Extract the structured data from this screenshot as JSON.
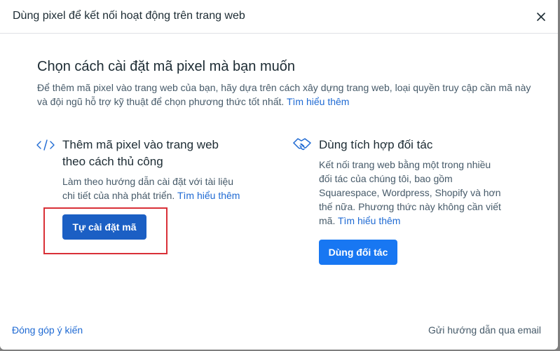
{
  "dialog": {
    "title": "Dùng pixel để kết nối hoạt động trên trang web"
  },
  "intro": {
    "heading": "Chọn cách cài đặt mã pixel mà bạn muốn",
    "description": "Để thêm mã pixel vào trang web của bạn, hãy dựa trên cách xây dựng trang web, loại quyền truy cập cần mã này và đội ngũ hỗ trợ kỹ thuật để chọn phương thức tốt nhất.",
    "learn_more": "Tìm hiểu thêm"
  },
  "options": [
    {
      "icon": "code-icon",
      "title_line1": "Thêm mã pixel vào trang web",
      "title_line2": "theo cách thủ công",
      "desc_line1": "Làm theo hướng dẫn cài đặt với tài liệu",
      "desc_line2": "chi tiết của nhà phát triển.",
      "learn_more": "Tìm hiểu thêm",
      "button_label": "Tự cài đặt mã"
    },
    {
      "icon": "handshake-icon",
      "title": "Dùng tích hợp đối tác",
      "desc_line1": "Kết nối trang web bằng một trong nhiều",
      "desc_line2": "đối tác của chúng tôi, bao gồm",
      "desc_line3": "Squarespace, Wordpress, Shopify và hơn",
      "desc_line4": "thế nữa. Phương thức này không cần viết",
      "desc_line5": "mã.",
      "learn_more": "Tìm hiểu thêm",
      "button_label": "Dùng đối tác"
    }
  ],
  "footer": {
    "feedback": "Đóng góp ý kiến",
    "email_instructions": "Gửi hướng dẫn qua email"
  },
  "colors": {
    "accent": "#1877f2",
    "link": "#1f6ad3",
    "highlight": "#d93037"
  }
}
